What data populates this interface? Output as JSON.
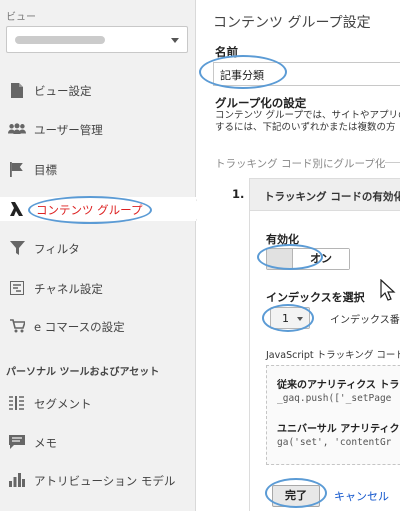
{
  "sidebar": {
    "view_label": "ビュー",
    "items": [
      {
        "label": "ビュー設定",
        "icon": "document-icon"
      },
      {
        "label": "ユーザー管理",
        "icon": "users-icon"
      },
      {
        "label": "目標",
        "icon": "flag-icon"
      },
      {
        "label": "コンテンツ グループ",
        "icon": "content-group-icon",
        "active": true
      },
      {
        "label": "フィルタ",
        "icon": "filter-icon"
      },
      {
        "label": "チャネル設定",
        "icon": "channel-icon"
      },
      {
        "label": "e コマースの設定",
        "icon": "cart-icon"
      }
    ],
    "section_title": "パーソナル ツールおよびアセット",
    "tools": [
      {
        "label": "セグメント",
        "icon": "segment-icon"
      },
      {
        "label": "メモ",
        "icon": "memo-icon"
      },
      {
        "label": "アトリビューション モデル",
        "icon": "attribution-icon"
      }
    ]
  },
  "main": {
    "title": "コンテンツ グループ設定",
    "name_label": "名前",
    "name_value": "記事分類",
    "group_heading": "グループ化の設定",
    "group_desc_line1": "コンテンツ グループでは、サイトやアプリのコ",
    "group_desc_line2": "するには、下記のいずれかまたは複数の方",
    "track_heading": "トラッキング コード別にグループ化",
    "step": {
      "number": "1.",
      "header": "トラッキング コードの有効化",
      "enable_label": "有効化",
      "toggle_on": "オン",
      "index_label": "インデックスを選択",
      "index_value": "1",
      "index_after": "インデックス番号",
      "js_label": "JavaScript トラッキング コードを",
      "code1_heading": "従来のアナリティクス トラ",
      "code1": "_gaq.push(['_setPage",
      "code2_heading": "ユニバーサル アナリティク",
      "code2": "ga('set', 'contentGr",
      "done": "完了",
      "cancel": "キャンセル"
    }
  },
  "colors": {
    "active_text": "#dd2222",
    "annotation": "#5b9bd5",
    "link": "#1155cc"
  }
}
